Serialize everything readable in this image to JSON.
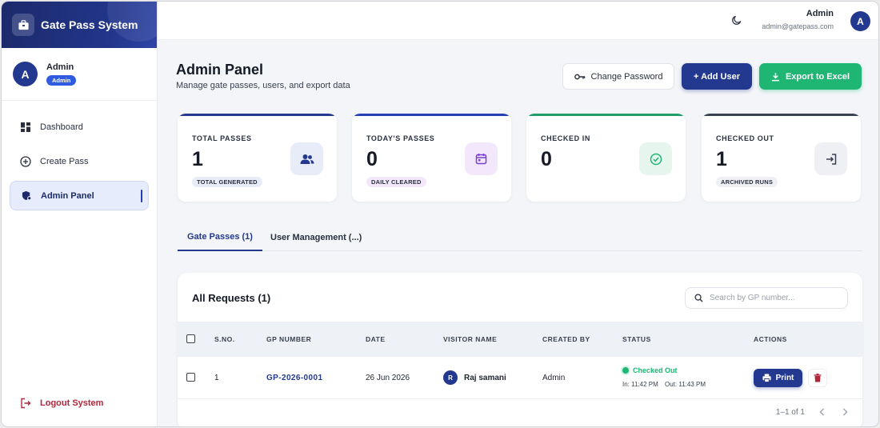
{
  "app": {
    "title": "Gate Pass System",
    "accent_color": "#23398f",
    "success_color": "#1fb673",
    "danger_color": "#b0263a"
  },
  "sidebar": {
    "user": {
      "initial": "A",
      "name": "Admin",
      "role": "Admin"
    },
    "items": [
      {
        "label": "Dashboard",
        "icon": "dashboard-icon",
        "active": false
      },
      {
        "label": "Create Pass",
        "icon": "plus-circle-icon",
        "active": false
      },
      {
        "label": "Admin Panel",
        "icon": "shield-user-icon",
        "active": true
      }
    ],
    "logout_label": "Logout System"
  },
  "topbar": {
    "theme_icon": "moon-icon",
    "user_name": "Admin",
    "user_email": "admin@gatepass.com",
    "user_initial": "A"
  },
  "header": {
    "title": "Admin Panel",
    "subtitle": "Manage gate passes, users, and export data",
    "change_password_label": "Change Password",
    "add_user_label": "+ Add User",
    "export_label": "Export to Excel"
  },
  "stats": [
    {
      "label": "TOTAL PASSES",
      "value": "1",
      "badge": "TOTAL GENERATED",
      "icon": "users-icon",
      "bar_color": "#23398f",
      "icon_bg": "#e8ecf9",
      "icon_color": "#23398f",
      "badge_bg": "#e8ecf9"
    },
    {
      "label": "TODAY'S PASSES",
      "value": "0",
      "badge": "DAILY CLEARED",
      "icon": "calendar-icon",
      "bar_color": "#2341b5",
      "icon_bg": "#f3e8fb",
      "icon_color": "#7b3fd1",
      "badge_bg": "#f3e8fb"
    },
    {
      "label": "CHECKED IN",
      "value": "0",
      "badge": "",
      "icon": "check-circle-icon",
      "bar_color": "#1f9e6a",
      "icon_bg": "#e6f6ee",
      "icon_color": "#1fb673",
      "badge_bg": ""
    },
    {
      "label": "CHECKED OUT",
      "value": "1",
      "badge": "ARCHIVED RUNS",
      "icon": "logout-box-icon",
      "bar_color": "#3b4150",
      "icon_bg": "#eef0f3",
      "icon_color": "#3b4150",
      "badge_bg": "#eef0f3"
    }
  ],
  "tabs": [
    {
      "label": "Gate Passes (1)",
      "active": true
    },
    {
      "label": "User Management (...)",
      "active": false
    }
  ],
  "requests": {
    "title": "All Requests (1)",
    "search_placeholder": "Search by GP number...",
    "columns": [
      "S.NO.",
      "GP NUMBER",
      "DATE",
      "VISITOR NAME",
      "CREATED BY",
      "STATUS",
      "ACTIONS"
    ],
    "rows": [
      {
        "sno": "1",
        "gp_number": "GP-2026-0001",
        "date": "26 Jun 2026",
        "visitor_initial": "R",
        "visitor_name": "Raj samani",
        "created_by": "Admin",
        "status": "Checked Out",
        "in_time": "In: 11:42 PM",
        "out_time": "Out: 11:43 PM",
        "print_label": "Print"
      }
    ],
    "pagination": "1–1 of 1"
  }
}
